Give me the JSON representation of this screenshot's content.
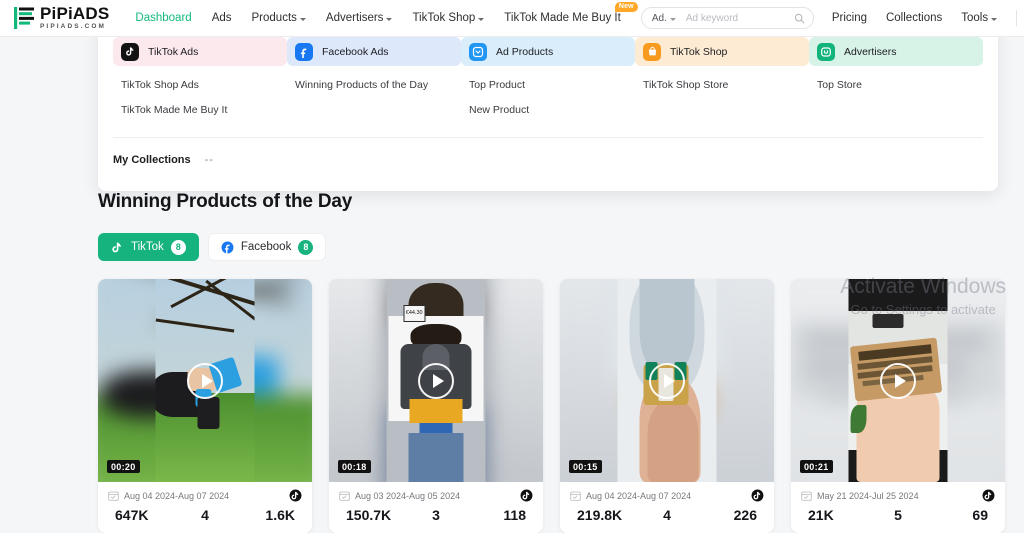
{
  "brand": {
    "name": "PiPiADS",
    "sub": "PIPIADS.COM",
    "logo_icon": "pipiads-bars-logo"
  },
  "nav": {
    "items": [
      {
        "label": "Dashboard",
        "active": true,
        "caret": false,
        "badge": null
      },
      {
        "label": "Ads",
        "active": false,
        "caret": false,
        "badge": null
      },
      {
        "label": "Products",
        "active": false,
        "caret": true,
        "badge": null
      },
      {
        "label": "Advertisers",
        "active": false,
        "caret": true,
        "badge": null
      },
      {
        "label": "TikTok Shop",
        "active": false,
        "caret": true,
        "badge": null
      },
      {
        "label": "TikTok Made Me Buy It",
        "active": false,
        "caret": false,
        "badge": "New"
      }
    ]
  },
  "search": {
    "scope_label": "Ad.",
    "placeholder": "Ad keyword",
    "value": "",
    "icon": "search-icon"
  },
  "right_nav": {
    "items": [
      {
        "label": "Pricing",
        "caret": false
      },
      {
        "label": "Collections",
        "caret": false
      },
      {
        "label": "Tools",
        "caret": true
      }
    ],
    "account_icon": "user-avatar-icon"
  },
  "mega_menu": {
    "columns": [
      {
        "title": "TikTok Ads",
        "icon": "tiktok-icon",
        "header_bg": "#fce9ee",
        "icon_bg": "#121212",
        "links": [
          "TikTok Shop Ads",
          "TikTok Made Me Buy It"
        ]
      },
      {
        "title": "Facebook Ads",
        "icon": "facebook-icon",
        "header_bg": "#dde8fb",
        "icon_bg": "#1877f2",
        "links": [
          "Winning Products of the Day"
        ]
      },
      {
        "title": "Ad Products",
        "icon": "ad-products-icon",
        "header_bg": "#d9edfb",
        "icon_bg": "#2196f3",
        "links": [
          "Top Product",
          "New Product"
        ]
      },
      {
        "title": "TikTok Shop",
        "icon": "shopping-bag-icon",
        "header_bg": "#fdebd3",
        "icon_bg": "#f79a1f",
        "links": [
          "TikTok Shop Store"
        ]
      },
      {
        "title": "Advertisers",
        "icon": "advertisers-box-icon",
        "header_bg": "#d7f2e7",
        "icon_bg": "#13b37c",
        "links": [
          "Top Store"
        ]
      }
    ],
    "my_collections": {
      "label": "My Collections",
      "value": "--"
    }
  },
  "main": {
    "title": "Winning Products of the Day",
    "tabs": [
      {
        "label": "TikTok",
        "count": "8",
        "icon": "tiktok-icon",
        "active": true
      },
      {
        "label": "Facebook",
        "count": "8",
        "icon": "facebook-icon",
        "active": false
      }
    ],
    "cards": [
      {
        "duration": "00:20",
        "dates": "Aug 04 2024-Aug 07 2024",
        "platform_icon": "tiktok-icon",
        "stats": [
          "647K",
          "4",
          "1.6K"
        ],
        "thumb": "garden-pruning-shears"
      },
      {
        "duration": "00:18",
        "dates": "Aug 03 2024-Aug 05 2024",
        "platform_icon": "tiktok-icon",
        "stats": [
          "150.7K",
          "3",
          "118"
        ],
        "thumb": "man-holding-hoodie",
        "price_tag": "€44.30"
      },
      {
        "duration": "00:15",
        "dates": "Aug 04 2024-Aug 07 2024",
        "platform_icon": "tiktok-icon",
        "stats": [
          "219.8K",
          "4",
          "226"
        ],
        "thumb": "emerald-gold-ring"
      },
      {
        "duration": "00:21",
        "dates": "May 21 2024-Jul 25 2024",
        "platform_icon": "tiktok-icon",
        "stats": [
          "21K",
          "5",
          "69"
        ],
        "thumb": "dear-husband-wallet-card"
      }
    ]
  },
  "watermark": {
    "line1": "Activate Windows",
    "line2": "Go to Settings to activate"
  },
  "colors": {
    "accent_green": "#16b37e",
    "nav_active": "#13b97b",
    "badge_orange": "#ffa726",
    "page_bg": "#f5f6f8"
  }
}
